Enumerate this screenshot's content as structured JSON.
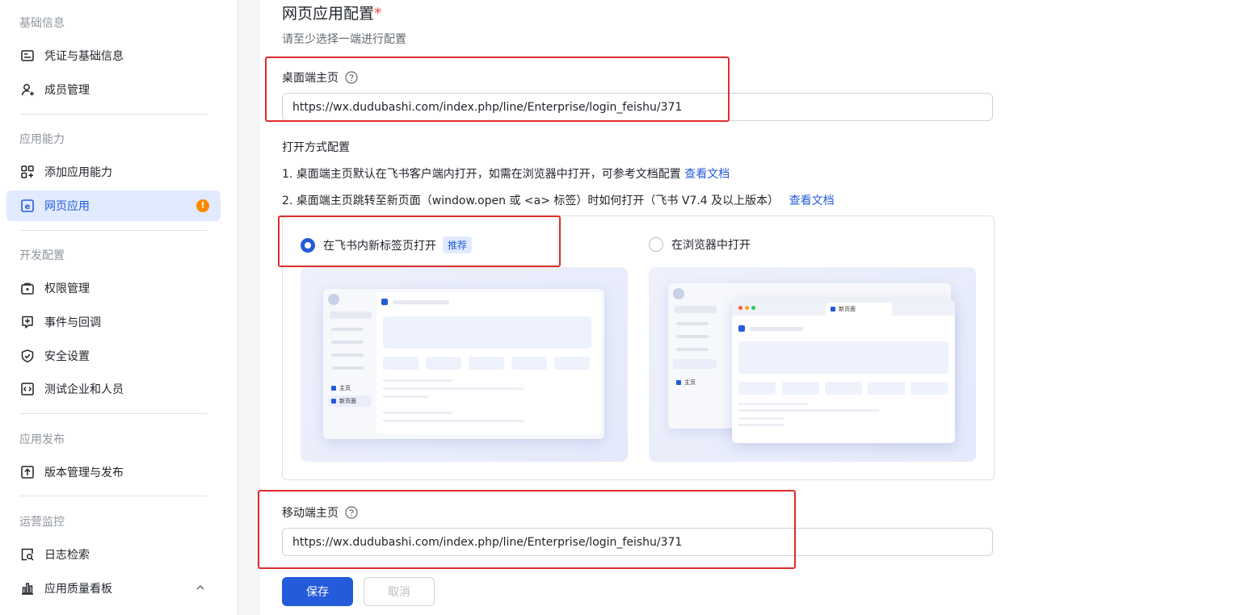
{
  "sidebar": {
    "sections": [
      {
        "title": "基础信息",
        "items": [
          {
            "label": "凭证与基础信息",
            "icon": "credential-icon"
          },
          {
            "label": "成员管理",
            "icon": "add-member-icon"
          }
        ]
      },
      {
        "title": "应用能力",
        "items": [
          {
            "label": "添加应用能力",
            "icon": "add-capability-icon"
          },
          {
            "label": "网页应用",
            "icon": "web-app-icon",
            "active": true,
            "badge": "!"
          }
        ]
      },
      {
        "title": "开发配置",
        "items": [
          {
            "label": "权限管理",
            "icon": "permission-icon"
          },
          {
            "label": "事件与回调",
            "icon": "event-callback-icon"
          },
          {
            "label": "安全设置",
            "icon": "shield-icon"
          },
          {
            "label": "测试企业和人员",
            "icon": "code-icon"
          }
        ]
      },
      {
        "title": "应用发布",
        "items": [
          {
            "label": "版本管理与发布",
            "icon": "upload-icon"
          }
        ]
      },
      {
        "title": "运营监控",
        "items": [
          {
            "label": "日志检索",
            "icon": "log-search-icon"
          },
          {
            "label": "应用质量看板",
            "icon": "bar-chart-icon"
          }
        ]
      }
    ]
  },
  "main": {
    "title": "网页应用配置",
    "required_mark": "*",
    "subtitle": "请至少选择一端进行配置",
    "desktop": {
      "label": "桌面端主页",
      "value": "https://wx.dudubashi.com/index.php/line/Enterprise/login_feishu/371"
    },
    "open_mode": {
      "label": "打开方式配置",
      "line1_text": "1. 桌面端主页默认在飞书客户端内打开，如需在浏览器中打开，可参考文档配置",
      "line1_link": "查看文档",
      "line2_text": "2. 桌面端主页跳转至新页面（window.open 或 <a> 标签）时如何打开（飞书 V7.4 及以上版本）",
      "line2_link": "查看文档",
      "option1": {
        "label": "在飞书内新标签页打开",
        "tag": "推荐",
        "selected": true
      },
      "option2": {
        "label": "在浏览器中打开",
        "selected": false
      },
      "preview1": {
        "nav_home": "主页",
        "nav_new": "新页面"
      },
      "preview2": {
        "tab_new": "新页面",
        "nav_home": "主页"
      }
    },
    "mobile": {
      "label": "移动端主页",
      "value": "https://wx.dudubashi.com/index.php/line/Enterprise/login_feishu/371"
    },
    "buttons": {
      "save": "保存",
      "cancel": "取消"
    }
  },
  "colors": {
    "accent": "#245bdb",
    "annotation_red": "#e02b2b",
    "warning": "#ff8800"
  }
}
